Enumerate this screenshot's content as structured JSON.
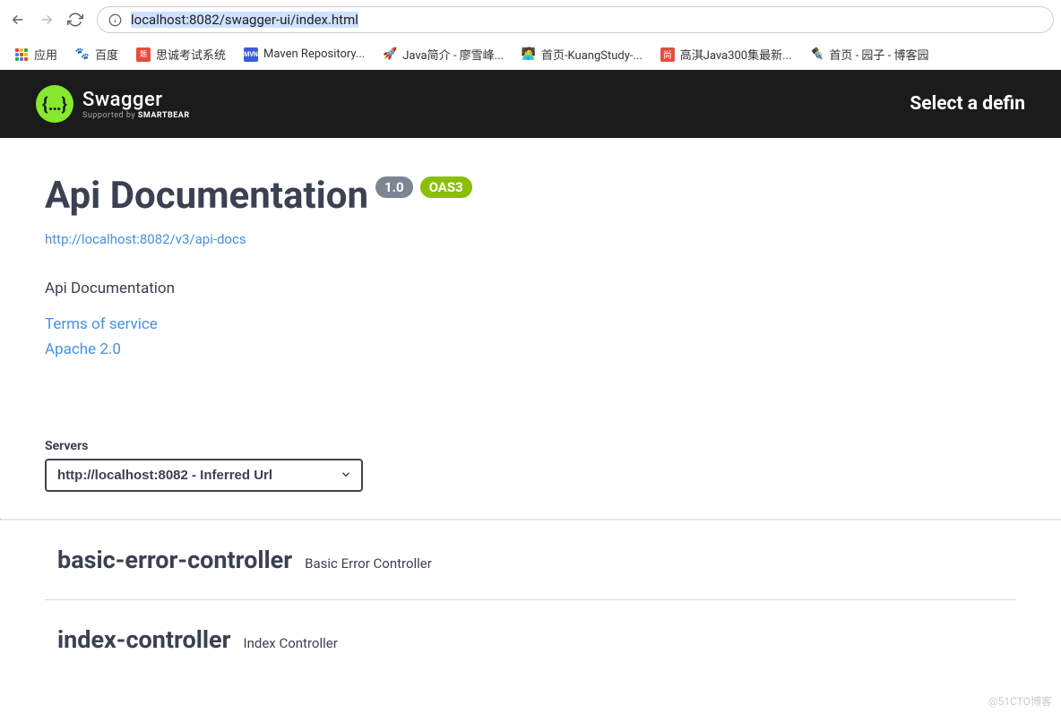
{
  "browser": {
    "url_proto_host": "localhost:8082",
    "url_path": "/swagger-ui/index.html"
  },
  "bookmarks": {
    "apps": "应用",
    "items": [
      "百度",
      "思诚考试系统",
      "Maven Repository...",
      "Java简介 - 廖雪峰...",
      "首页-KuangStudy-...",
      "高淇Java300集最新...",
      "首页 - 园子 - 博客园"
    ]
  },
  "header": {
    "brand": "Swagger",
    "supported_prefix": "Supported by ",
    "supported_name": "SMARTBEAR",
    "right_label": "Select a defin"
  },
  "info": {
    "title": "Api Documentation",
    "version": "1.0",
    "oas": "OAS3",
    "docs_url": "http://localhost:8082/v3/api-docs",
    "description": "Api Documentation",
    "terms": "Terms of service",
    "license": "Apache 2.0"
  },
  "servers": {
    "label": "Servers",
    "selected": "http://localhost:8082 - Inferred Url"
  },
  "controllers": [
    {
      "name": "basic-error-controller",
      "desc": "Basic Error Controller"
    },
    {
      "name": "index-controller",
      "desc": "Index Controller"
    }
  ],
  "watermark": "@51CTO博客"
}
